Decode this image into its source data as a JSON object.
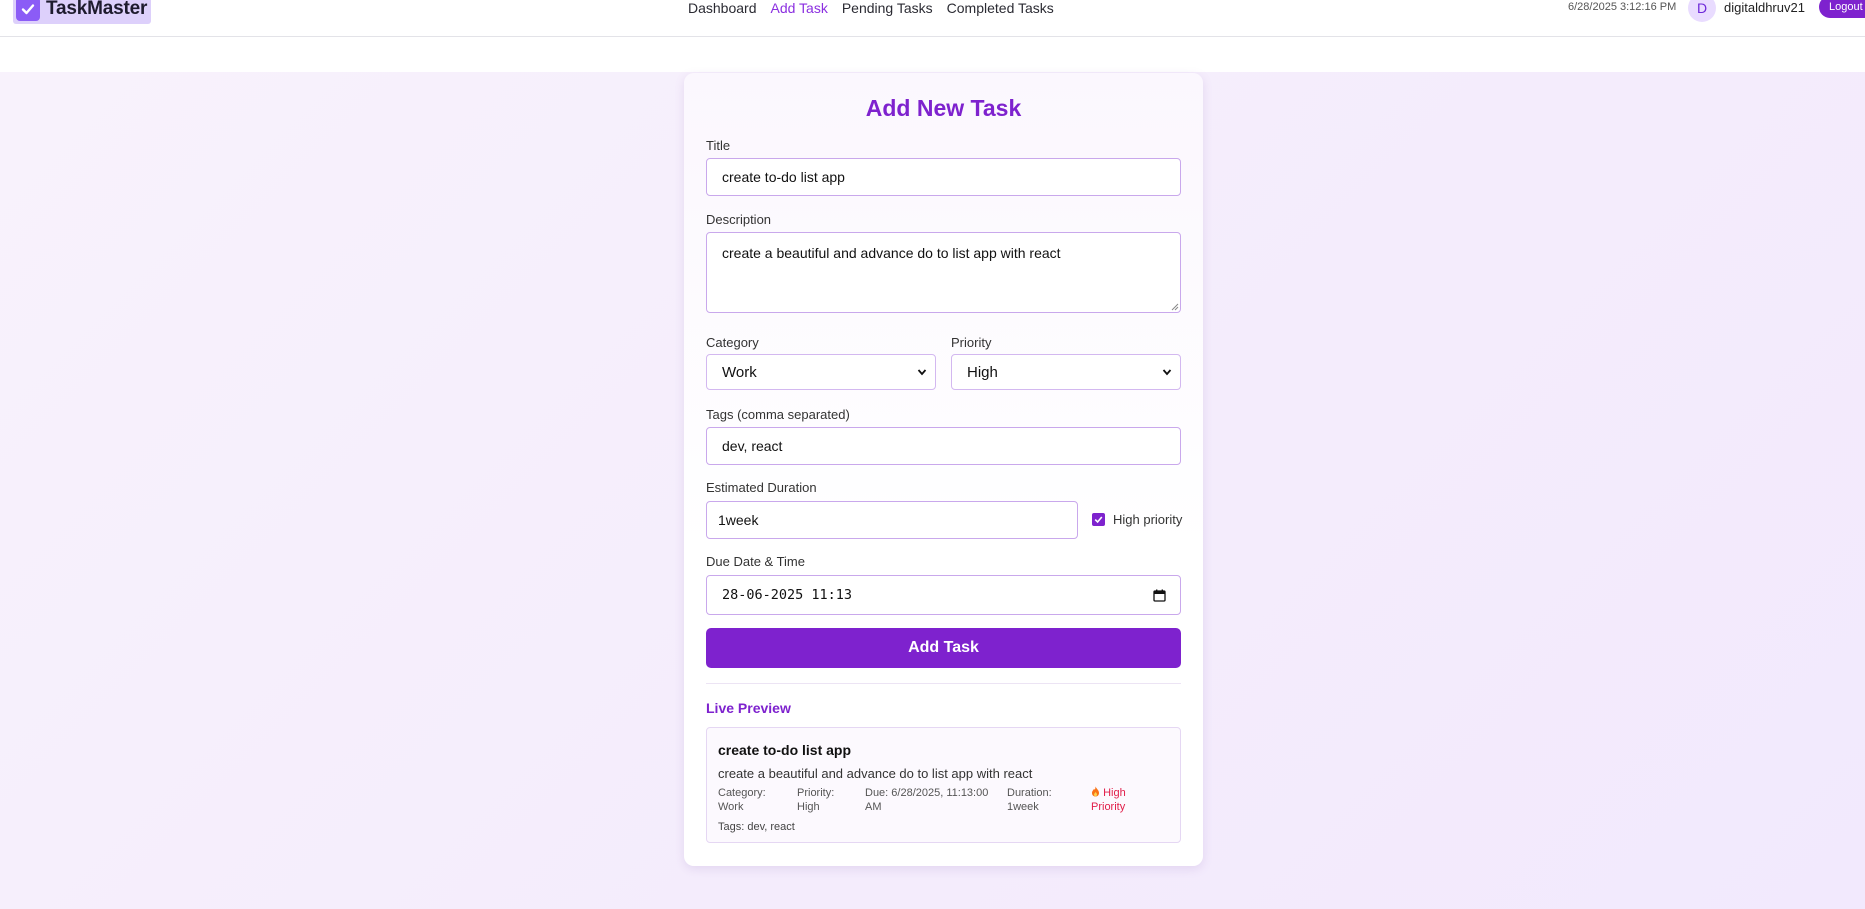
{
  "header": {
    "brand": "TaskMaster",
    "nav": [
      {
        "label": "Dashboard",
        "active": false
      },
      {
        "label": "Add Task",
        "active": true
      },
      {
        "label": "Pending Tasks",
        "active": false
      },
      {
        "label": "Completed Tasks",
        "active": false
      }
    ],
    "datetime": "6/28/2025 3:12:16 PM",
    "avatar_initial": "D",
    "username": "digitaldhruv21",
    "logout_label": "Logout"
  },
  "form": {
    "heading": "Add New Task",
    "title": {
      "label": "Title",
      "value": "create to-do list app"
    },
    "description": {
      "label": "Description",
      "value": "create a beautiful and advance do to list app with react"
    },
    "category": {
      "label": "Category",
      "value": "Work"
    },
    "priority": {
      "label": "Priority",
      "value": "High"
    },
    "tags": {
      "label": "Tags (comma separated)",
      "value": "dev, react"
    },
    "duration": {
      "label": "Estimated Duration",
      "value": "1week"
    },
    "high_priority": {
      "label": "High priority",
      "checked": true
    },
    "due": {
      "label": "Due Date & Time",
      "value": "28-06-2025  11:13"
    },
    "submit_label": "Add Task"
  },
  "preview": {
    "heading": "Live Preview",
    "title": "create to-do list app",
    "description": "create a beautiful and advance do to list app with react",
    "category_label": "Category:",
    "category_value": "Work",
    "priority_label": "Priority:",
    "priority_value": "High",
    "due_line1": "Due: 6/28/2025, 11:13:00",
    "due_line2": "AM",
    "duration_label": "Duration:",
    "duration_value": "1week",
    "high_line1": "High",
    "high_line2": "Priority",
    "tags": "Tags: dev, react"
  },
  "colors": {
    "accent": "#7e22ce",
    "active_nav": "#8b2fe0",
    "high_priority": "#e11d48",
    "logo_bg": "#ddd0fb"
  },
  "icons": {
    "logo": "check-square-icon",
    "select_arrow": "chevron-down-icon",
    "date_picker": "calendar-icon",
    "high_priority": "fire-icon"
  }
}
